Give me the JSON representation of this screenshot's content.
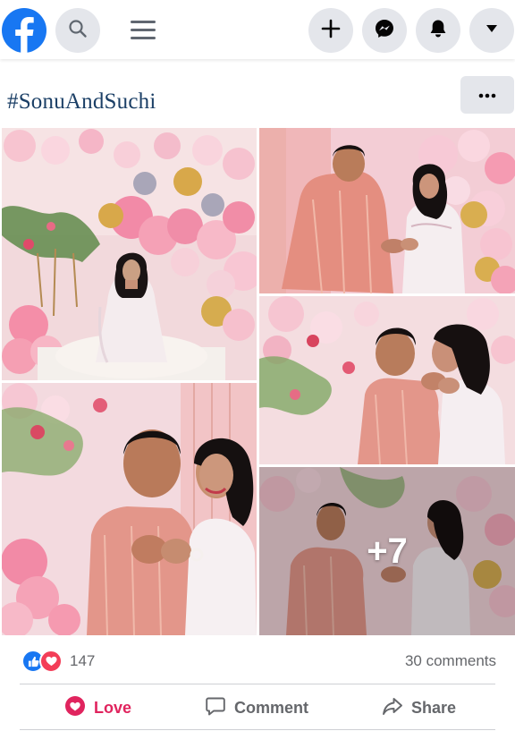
{
  "app": {
    "logo_icon": "facebook-logo",
    "brand_color": "#1877f2"
  },
  "topbar": {
    "search_icon": "search-icon",
    "menu_icon": "hamburger-menu-icon",
    "actions": [
      {
        "name": "create-button",
        "icon": "plus-icon"
      },
      {
        "name": "messenger-button",
        "icon": "messenger-icon"
      },
      {
        "name": "notifications-button",
        "icon": "bell-icon"
      },
      {
        "name": "account-button",
        "icon": "caret-down-icon"
      }
    ]
  },
  "post": {
    "hashtag": "#SonuAndSuchi",
    "more_icon": "more-horizontal-icon",
    "photos": [
      {
        "subject": "photo-bride-seated"
      },
      {
        "subject": "photo-couple-ring"
      },
      {
        "subject": "photo-couple-close"
      },
      {
        "subject": "photo-couple-fists"
      },
      {
        "subject": "photo-couple-kneeling",
        "more_count": "+7"
      }
    ],
    "reactions": {
      "icons": [
        "like-icon",
        "love-icon"
      ],
      "count": "147",
      "like_color": "#1877f2",
      "love_color": "#f33e58"
    },
    "comments_count": "30 comments",
    "actions": {
      "love_label": "Love",
      "comment_label": "Comment",
      "share_label": "Share",
      "love_color": "#e0245e"
    }
  }
}
